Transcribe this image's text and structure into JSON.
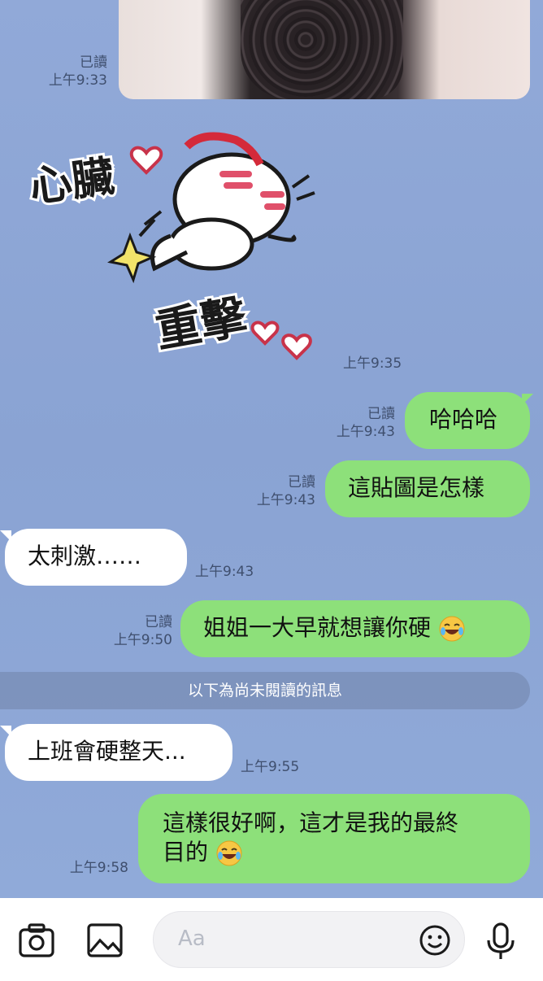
{
  "messages": {
    "photo": {
      "read": "已讀",
      "time": "上午9:33"
    },
    "sticker": {
      "time": "上午9:35",
      "text_top": "心臟",
      "text_bottom": "重擊"
    },
    "m1": {
      "read": "已讀",
      "time": "上午9:43",
      "text": "哈哈哈"
    },
    "m2": {
      "read": "已讀",
      "time": "上午9:43",
      "text": "這貼圖是怎樣"
    },
    "m3": {
      "time": "上午9:43",
      "text": "太刺激……"
    },
    "m4": {
      "read": "已讀",
      "time": "上午9:50",
      "text": "姐姐一大早就想讓你硬"
    },
    "m5": {
      "time": "上午9:55",
      "text": "上班會硬整天..."
    },
    "m6": {
      "time": "上午9:58",
      "line1": "這樣很好啊，這才是我的最終",
      "line2": "目的"
    }
  },
  "unread_divider": "以下為尚未閱讀的訊息",
  "composer": {
    "placeholder": "Aa",
    "icons": [
      "camera-icon",
      "image-icon",
      "emoji-icon",
      "microphone-icon"
    ]
  },
  "colors": {
    "outgoing": "#8de07a",
    "incoming": "#ffffff",
    "background": "#8fa8d6"
  }
}
